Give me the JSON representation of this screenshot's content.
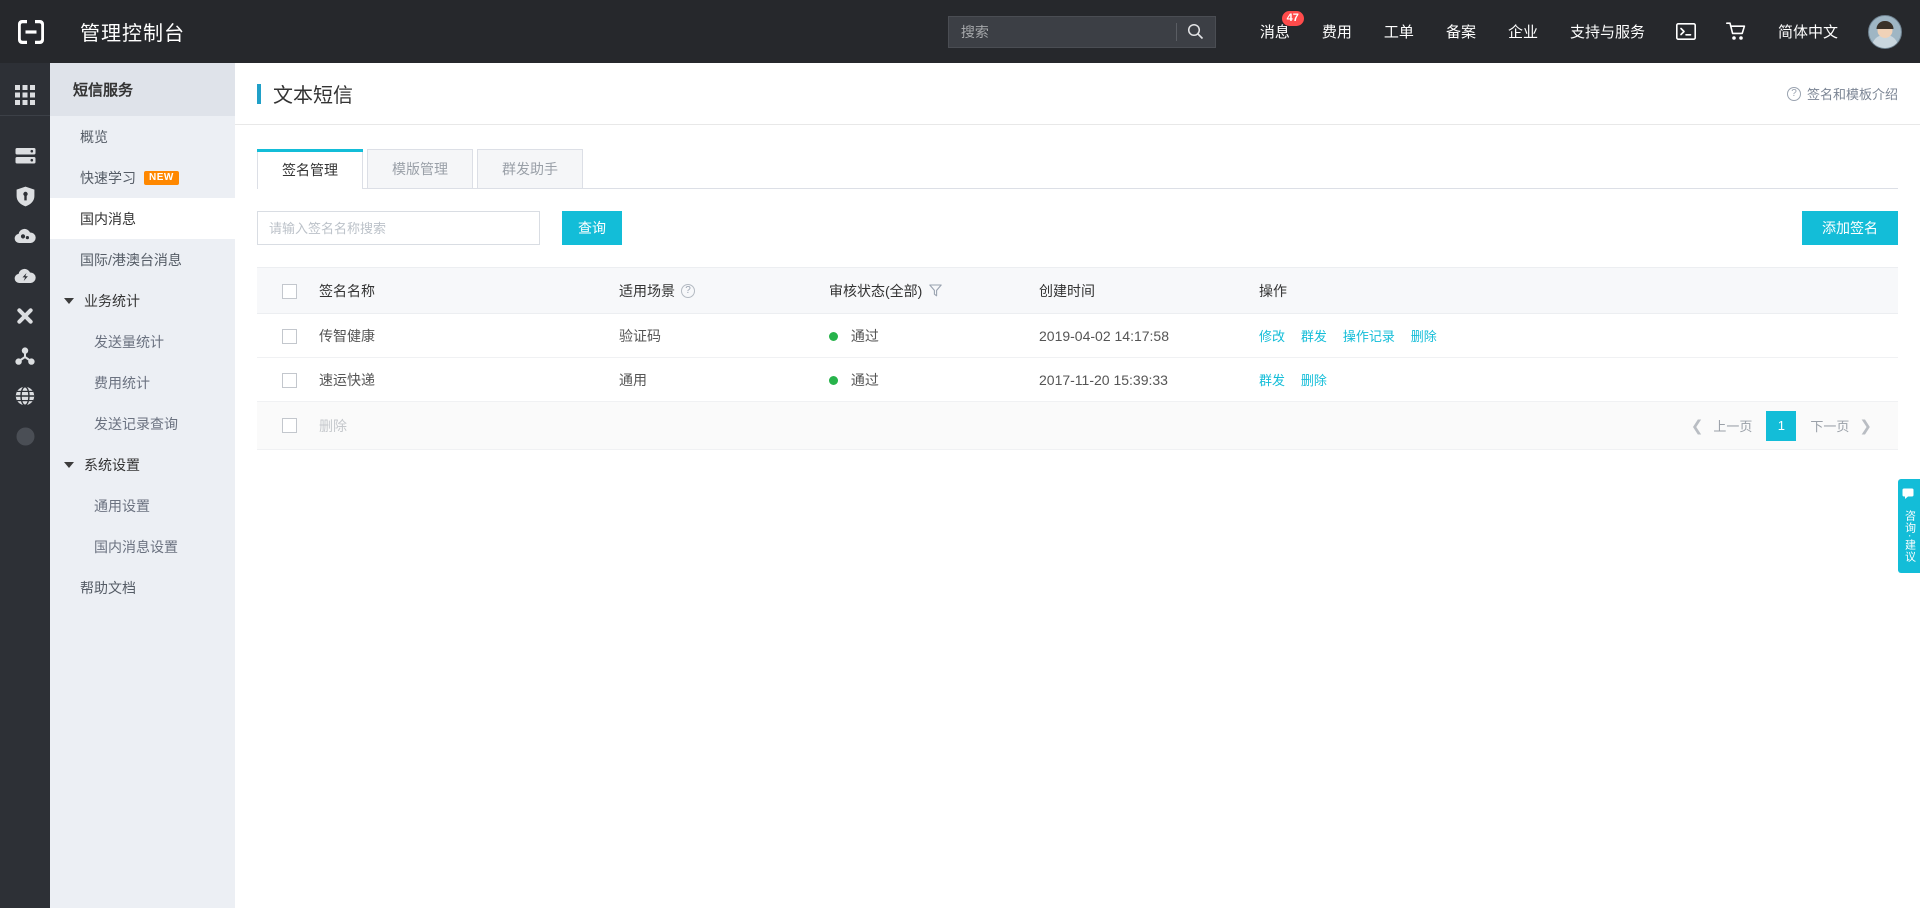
{
  "topbar": {
    "logo_icon": "aliyun-logo-icon",
    "console_title": "管理控制台",
    "search": {
      "placeholder": "搜索",
      "value": "",
      "icon": "search-icon"
    },
    "nav": [
      {
        "label": "消息",
        "badge": "47",
        "name": "nav-messages"
      },
      {
        "label": "费用",
        "badge": "",
        "name": "nav-billing"
      },
      {
        "label": "工单",
        "badge": "",
        "name": "nav-tickets"
      },
      {
        "label": "备案",
        "badge": "",
        "name": "nav-icp"
      },
      {
        "label": "企业",
        "badge": "",
        "name": "nav-enterprise"
      },
      {
        "label": "支持与服务",
        "badge": "",
        "name": "nav-support"
      }
    ],
    "terminal_icon": "terminal-icon",
    "cart_icon": "shopping-cart-icon",
    "language": "简体中文",
    "avatar": "user-avatar"
  },
  "rail": {
    "items": [
      {
        "icon": "grid-apps-icon",
        "name": "rail-item-products"
      },
      {
        "icon": "server-stack-icon",
        "name": "rail-item-ecs"
      },
      {
        "icon": "shield-icon",
        "name": "rail-item-security"
      },
      {
        "icon": "cloud-icon",
        "name": "rail-item-cloud"
      },
      {
        "icon": "cloud-db-icon",
        "name": "rail-item-database"
      },
      {
        "icon": "network-nodes-icon",
        "name": "rail-item-network"
      },
      {
        "icon": "share-nodes-icon",
        "name": "rail-item-share"
      },
      {
        "icon": "globe-icon",
        "name": "rail-item-cdn"
      },
      {
        "icon": "circle-icon",
        "name": "rail-item-more"
      }
    ]
  },
  "sidebar": {
    "header": "短信服务",
    "items": [
      {
        "label": "概览",
        "type": "item",
        "active": false,
        "name": "sidebar-item-overview"
      },
      {
        "label": "快速学习",
        "type": "item",
        "active": false,
        "tag": "NEW",
        "name": "sidebar-item-quickstart"
      },
      {
        "label": "国内消息",
        "type": "item",
        "active": true,
        "name": "sidebar-item-domestic"
      },
      {
        "label": "国际/港澳台消息",
        "type": "item",
        "active": false,
        "name": "sidebar-item-international"
      },
      {
        "label": "业务统计",
        "type": "group",
        "active": false,
        "name": "sidebar-group-statistics"
      },
      {
        "label": "发送量统计",
        "type": "sub",
        "active": false,
        "name": "sidebar-item-send-count"
      },
      {
        "label": "费用统计",
        "type": "sub",
        "active": false,
        "name": "sidebar-item-cost-stat"
      },
      {
        "label": "发送记录查询",
        "type": "sub",
        "active": false,
        "name": "sidebar-item-send-records"
      },
      {
        "label": "系统设置",
        "type": "group",
        "active": false,
        "name": "sidebar-group-settings"
      },
      {
        "label": "通用设置",
        "type": "sub",
        "active": false,
        "name": "sidebar-item-general-settings"
      },
      {
        "label": "国内消息设置",
        "type": "sub",
        "active": false,
        "name": "sidebar-item-domestic-settings"
      },
      {
        "label": "帮助文档",
        "type": "item",
        "active": false,
        "name": "sidebar-item-help-docs"
      }
    ]
  },
  "page": {
    "title": "文本短信",
    "help_link": "签名和模板介绍",
    "help_icon": "question-circle-icon"
  },
  "tabs": [
    {
      "label": "签名管理",
      "active": true,
      "name": "tab-signature-management"
    },
    {
      "label": "模版管理",
      "active": false,
      "name": "tab-template-management"
    },
    {
      "label": "群发助手",
      "active": false,
      "name": "tab-bulk-assistant"
    }
  ],
  "query": {
    "placeholder": "请输入签名名称搜索",
    "value": "",
    "button": "查询",
    "add_button": "添加签名"
  },
  "table": {
    "columns": [
      {
        "label": "",
        "key": "check",
        "name": "col-select-all"
      },
      {
        "label": "签名名称",
        "key": "name",
        "name": "col-signature-name"
      },
      {
        "label": "适用场景",
        "key": "scene",
        "help": true,
        "name": "col-scene"
      },
      {
        "label": "审核状态(全部)",
        "key": "status",
        "filter": true,
        "name": "col-audit-status"
      },
      {
        "label": "创建时间",
        "key": "time",
        "name": "col-create-time"
      },
      {
        "label": "操作",
        "key": "actions",
        "name": "col-actions"
      }
    ],
    "rows": [
      {
        "name": "传智健康",
        "scene": "验证码",
        "status": "通过",
        "status_color": "#27b34b",
        "time": "2019-04-02 14:17:58",
        "actions": [
          "修改",
          "群发",
          "操作记录",
          "删除"
        ]
      },
      {
        "name": "速运快递",
        "scene": "通用",
        "status": "通过",
        "status_color": "#27b34b",
        "time": "2017-11-20 15:39:33",
        "actions": [
          "群发",
          "删除"
        ]
      }
    ],
    "footer": {
      "delete_label": "删除",
      "prev_label": "上一页",
      "next_label": "下一页",
      "current_page": "1"
    }
  },
  "consult": {
    "icon": "chat-bubble-icon",
    "label": "咨询·建议"
  },
  "colors": {
    "accent": "#13bdd8",
    "topbar_bg": "#26282c",
    "rail_bg": "#2d3036",
    "sidebar_bg": "#eceff4",
    "badge_red": "#ff4b4b",
    "status_green": "#27b34b",
    "tag_orange": "#ff8800"
  }
}
